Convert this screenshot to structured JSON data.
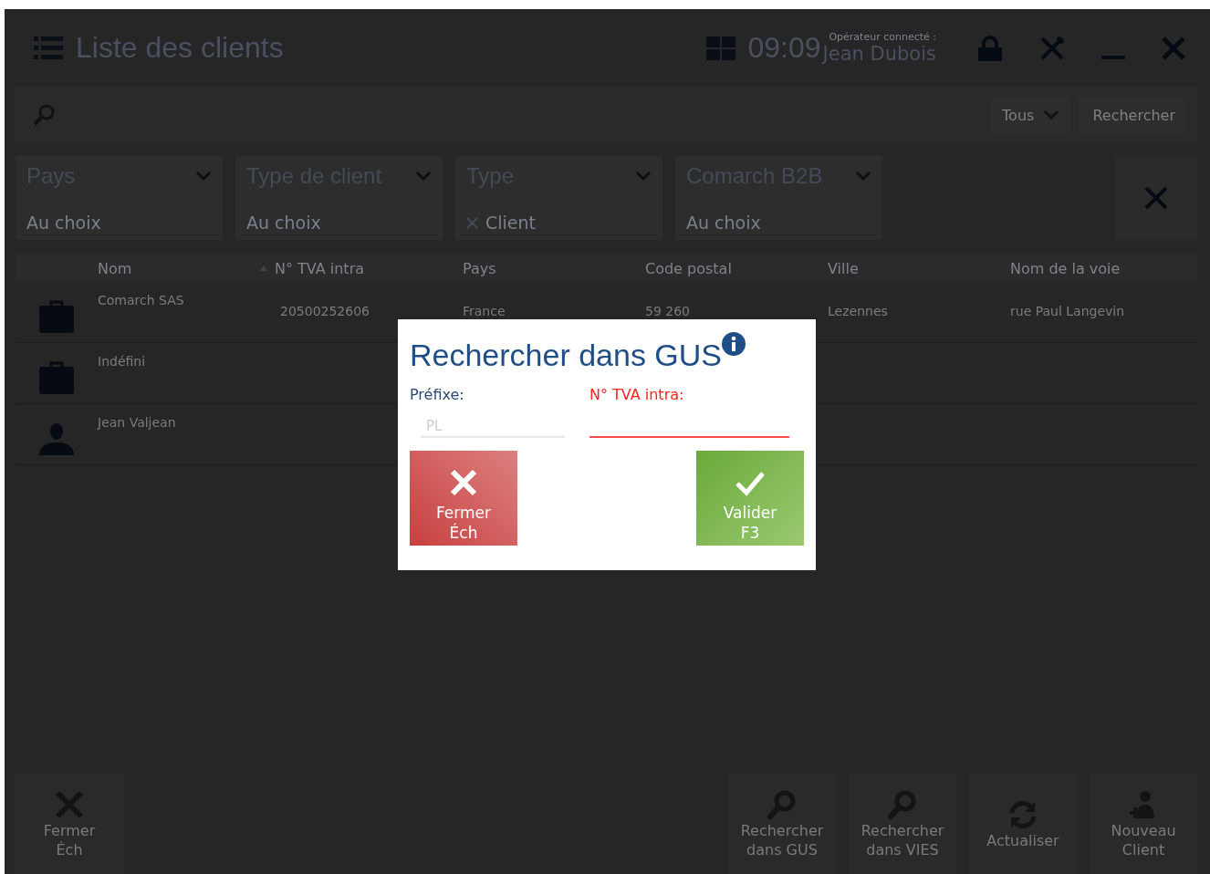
{
  "header": {
    "title": "Liste des clients",
    "time": "09:09",
    "operator_label": "Opérateur connecté :",
    "operator_name": "Jean Dubois"
  },
  "search": {
    "scope": "Tous",
    "button": "Rechercher"
  },
  "filters": [
    {
      "label": "Pays",
      "value": "Au choix",
      "kind": "choice"
    },
    {
      "label": "Type de client",
      "value": "Au choix",
      "kind": "choice"
    },
    {
      "label": "Type",
      "value": "Client",
      "kind": "chip"
    },
    {
      "label": "Comarch B2B",
      "value": "Au choix",
      "kind": "choice"
    }
  ],
  "table": {
    "columns": [
      {
        "label": "Nom",
        "sorted": false
      },
      {
        "label": "N° TVA intra",
        "sorted": true
      },
      {
        "label": "Pays",
        "sorted": false
      },
      {
        "label": "Code postal",
        "sorted": false
      },
      {
        "label": "Ville",
        "sorted": false
      },
      {
        "label": "Nom de la voie",
        "sorted": false
      }
    ],
    "rows": [
      {
        "kind": "company",
        "cells": [
          "Comarch SAS",
          "20500252606",
          "France",
          "59 260",
          "Lezennes",
          "rue Paul Langevin"
        ]
      },
      {
        "kind": "company",
        "cells": [
          "Indéfini"
        ]
      },
      {
        "kind": "person",
        "cells": [
          "Jean Valjean"
        ]
      }
    ]
  },
  "dialog": {
    "title": "Rechercher dans GUS",
    "prefix_label": "Préfixe:",
    "prefix_value": "PL",
    "prefix_disabled": true,
    "tva_label": "N° TVA intra:",
    "tva_invalid": true,
    "buttons": [
      {
        "kind": "cancel",
        "label": "Fermer",
        "key": "Éch"
      },
      {
        "kind": "ok",
        "label": "Valider",
        "key": "F3"
      }
    ]
  },
  "footer": {
    "left": [
      {
        "kind": "close",
        "lines": [
          "Fermer",
          "Éch"
        ]
      }
    ],
    "right": [
      {
        "kind": "gus",
        "lines": [
          "Rechercher",
          "dans GUS"
        ]
      },
      {
        "kind": "vies",
        "lines": [
          "Rechercher",
          "dans VIES"
        ]
      },
      {
        "kind": "refresh",
        "lines": [
          "Actualiser"
        ]
      },
      {
        "kind": "new",
        "lines": [
          "Nouveau",
          "Client"
        ]
      }
    ]
  }
}
